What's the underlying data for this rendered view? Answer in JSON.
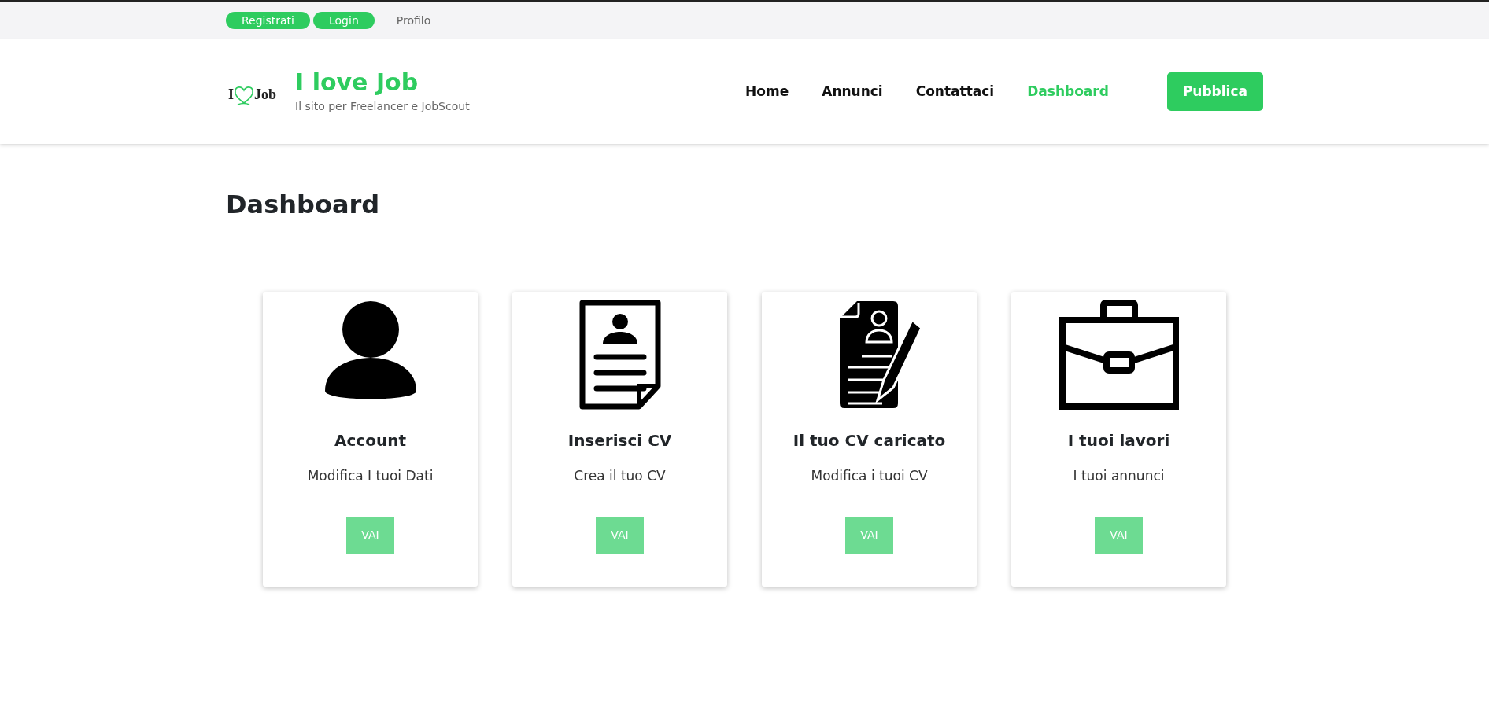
{
  "top_bar": {
    "buttons": [
      {
        "label": "Registrati"
      },
      {
        "label": "Login"
      }
    ],
    "link": "Profilo"
  },
  "brand": {
    "logo_left": "I",
    "logo_right": "Job",
    "title": "I love Job",
    "tagline": "Il sito per Freelancer e JobScout"
  },
  "nav": [
    {
      "label": "Home",
      "selected": false
    },
    {
      "label": "Annunci",
      "selected": false
    },
    {
      "label": "Contattaci",
      "selected": false
    },
    {
      "label": "Dashboard",
      "selected": true
    }
  ],
  "publish_button": "Pubblica",
  "heading": "Dashboard",
  "cards": [
    {
      "kind": "person",
      "title": "Account",
      "text": "Modifica I tuoi Dati",
      "button": "VAI"
    },
    {
      "kind": "resume",
      "title": "Inserisci CV",
      "text": "Crea il tuo CV",
      "button": "VAI"
    },
    {
      "kind": "resume-edit",
      "title": "Il tuo CV caricato",
      "text": "Modifica i tuoi CV",
      "button": "VAI"
    },
    {
      "kind": "briefcase",
      "title": "I tuoi lavori",
      "text": "I tuoi annunci",
      "button": "VAI"
    }
  ]
}
